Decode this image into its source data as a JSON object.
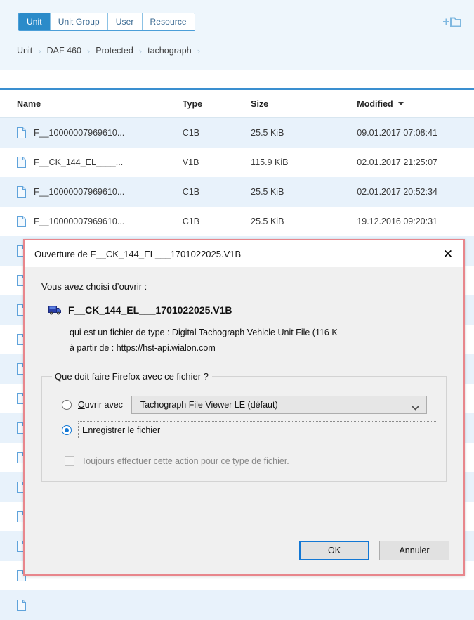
{
  "toolbar": {
    "tabs": [
      {
        "label": "Unit",
        "active": true
      },
      {
        "label": "Unit Group",
        "active": false
      },
      {
        "label": "User",
        "active": false
      },
      {
        "label": "Resource",
        "active": false
      }
    ],
    "add_folder_icon": "add-folder-icon"
  },
  "breadcrumb": {
    "items": [
      "Unit",
      "DAF 460",
      "Protected",
      "tachograph"
    ],
    "separator": "›"
  },
  "table": {
    "columns": [
      "Name",
      "Type",
      "Size",
      "Modified"
    ],
    "sort_column": "Modified",
    "sort_direction": "desc",
    "sort_icon": "caret-down-icon",
    "file_icon": "file-icon",
    "rows": [
      {
        "name": "F__10000007969610...",
        "type": "C1B",
        "size": "25.5 KiB",
        "modified": "09.01.2017 07:08:41"
      },
      {
        "name": "F__CK_144_EL____...",
        "type": "V1B",
        "size": "115.9 KiB",
        "modified": "02.01.2017 21:25:07"
      },
      {
        "name": "F__10000007969610...",
        "type": "C1B",
        "size": "25.5 KiB",
        "modified": "02.01.2017 20:52:34"
      },
      {
        "name": "F__10000007969610...",
        "type": "C1B",
        "size": "25.5 KiB",
        "modified": "19.12.2016 09:20:31"
      },
      {
        "name": "",
        "type": "",
        "size": "",
        "modified": ""
      },
      {
        "name": "",
        "type": "",
        "size": "",
        "modified": ""
      },
      {
        "name": "",
        "type": "",
        "size": "",
        "modified": ""
      },
      {
        "name": "",
        "type": "",
        "size": "",
        "modified": ""
      },
      {
        "name": "",
        "type": "",
        "size": "",
        "modified": ""
      },
      {
        "name": "",
        "type": "",
        "size": "",
        "modified": ""
      },
      {
        "name": "",
        "type": "",
        "size": "",
        "modified": ""
      },
      {
        "name": "",
        "type": "",
        "size": "",
        "modified": ""
      },
      {
        "name": "",
        "type": "",
        "size": "",
        "modified": ""
      },
      {
        "name": "",
        "type": "",
        "size": "",
        "modified": ""
      },
      {
        "name": "",
        "type": "",
        "size": "",
        "modified": ""
      },
      {
        "name": "",
        "type": "",
        "size": "",
        "modified": ""
      },
      {
        "name": "",
        "type": "",
        "size": "",
        "modified": ""
      }
    ]
  },
  "dialog": {
    "title": "Ouverture de F__CK_144_EL___1701022025.V1B",
    "close_label": "✕",
    "intro": "Vous avez choisi d’ouvrir :",
    "file_icon": "truck-icon",
    "filename": "F__CK_144_EL___1701022025.V1B",
    "type_line": "qui est un fichier de type : Digital Tachograph Vehicle Unit File (116 K",
    "source_line": "à partir de : https://hst-api.wialon.com",
    "group_legend": "Que doit faire Firefox avec ce fichier ?",
    "open_with_label_prefix": "",
    "open_with_accesskey": "O",
    "open_with_label_rest": "uvrir avec",
    "open_with_selected": false,
    "app_select_value": "Tachograph File Viewer LE (défaut)",
    "app_select_chevron": "chevron-down-icon",
    "save_accesskey": "E",
    "save_label_rest": "nregistrer le fichier",
    "save_selected": true,
    "always_accesskey": "T",
    "always_label_rest": "oujours effectuer cette action pour ce type de fichier.",
    "always_checked": false,
    "ok_label": "OK",
    "cancel_label": "Annuler"
  },
  "colors": {
    "accent_blue": "#2b8bc9",
    "table_top_rule": "#3a8fd0",
    "row_stripe": "#e8f2fb",
    "topbar_bg": "#eef6fc",
    "dialog_border": "#e8868c",
    "focus_blue": "#1277d4"
  }
}
